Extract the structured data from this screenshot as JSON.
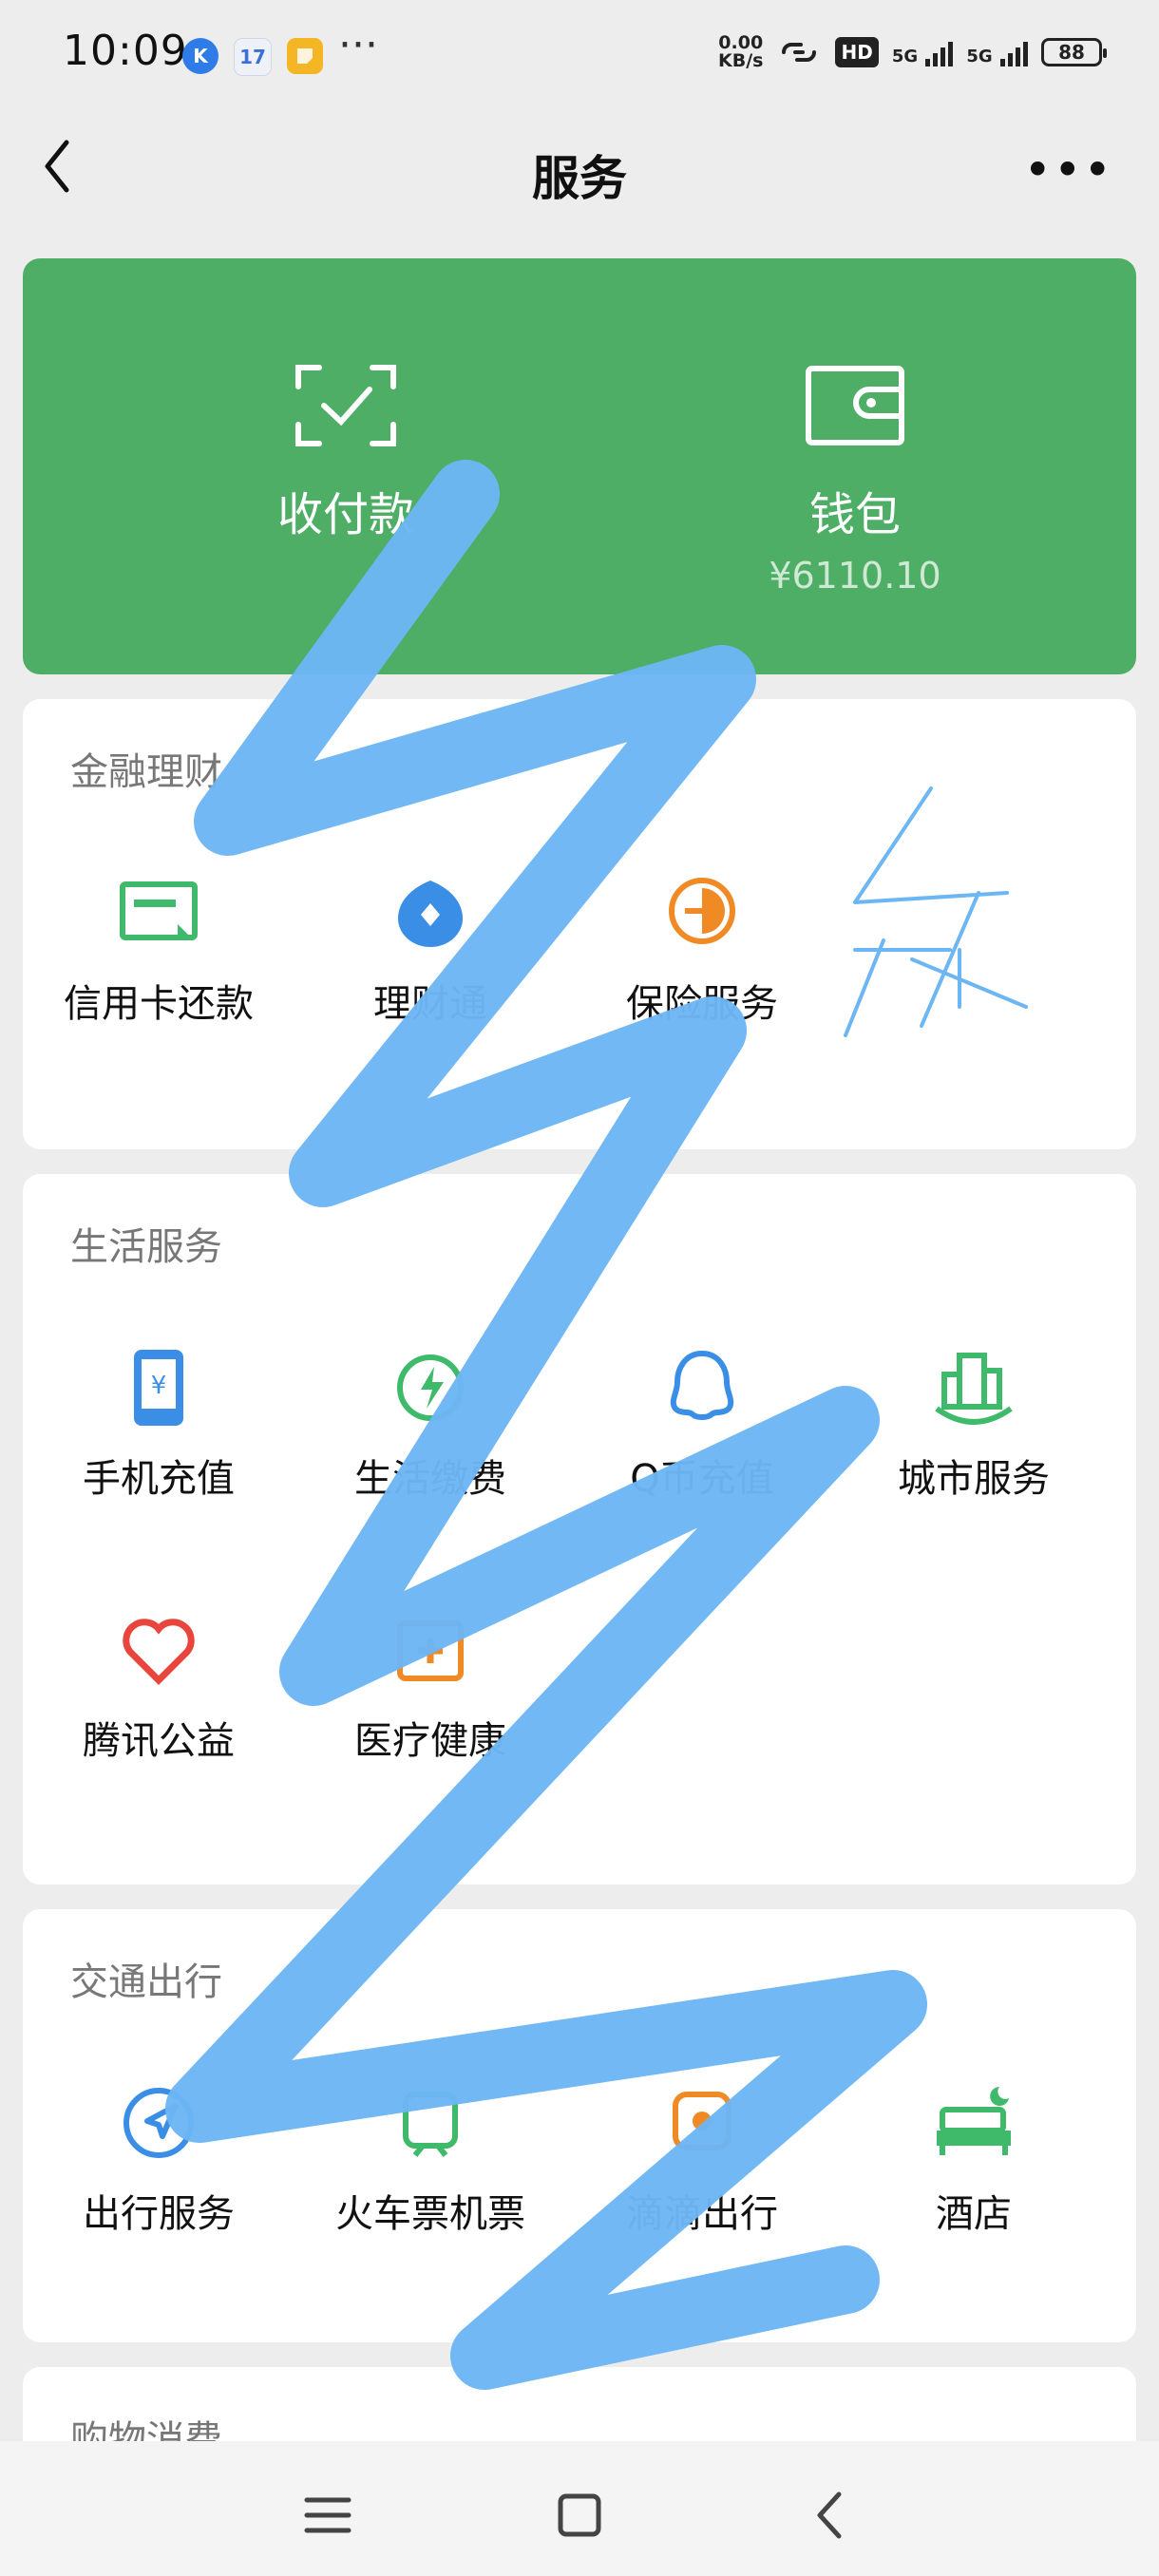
{
  "status_bar": {
    "time": "10:09",
    "notification_more": "···",
    "app_icons": [
      "K",
      "17",
      ""
    ],
    "net_speed_value": "0.00",
    "net_speed_unit": "KB/s",
    "hd_label": "HD",
    "sim1_label": "5G",
    "sim2_label": "5G",
    "battery": "88"
  },
  "nav": {
    "title": "服务",
    "more": "•••"
  },
  "pay_card": {
    "color": "#4fae66",
    "items": [
      {
        "label": "收付款",
        "icon": "scan-check-icon"
      },
      {
        "label": "钱包",
        "sub": "¥6110.10",
        "icon": "wallet-icon"
      }
    ]
  },
  "sections": [
    {
      "title": "金融理财",
      "items": [
        {
          "label": "信用卡还款",
          "icon": "credit-card-icon",
          "color": "#3fb96a"
        },
        {
          "label": "理财通",
          "icon": "wealth-icon",
          "color": "#3a8ee6"
        },
        {
          "label": "保险服务",
          "icon": "insurance-icon",
          "color": "#f08a24"
        }
      ]
    },
    {
      "title": "生活服务",
      "items": [
        {
          "label": "手机充值",
          "icon": "phone-recharge-icon",
          "color": "#3a8ee6"
        },
        {
          "label": "生活缴费",
          "icon": "utility-bill-icon",
          "color": "#3fb96a"
        },
        {
          "label": "Q币充值",
          "icon": "qq-icon",
          "color": "#3a8ee6"
        },
        {
          "label": "城市服务",
          "icon": "city-icon",
          "color": "#3fb96a"
        },
        {
          "label": "腾讯公益",
          "icon": "charity-icon",
          "color": "#e8453c"
        },
        {
          "label": "医疗健康",
          "icon": "medical-icon",
          "color": "#f08a24"
        }
      ]
    },
    {
      "title": "交通出行",
      "items": [
        {
          "label": "出行服务",
          "icon": "travel-icon",
          "color": "#3a8ee6"
        },
        {
          "label": "火车票机票",
          "icon": "ticket-icon",
          "color": "#3fb96a"
        },
        {
          "label": "滴滴出行",
          "icon": "didi-icon",
          "color": "#f08a24"
        },
        {
          "label": "酒店",
          "icon": "hotel-icon",
          "color": "#3fb96a"
        }
      ]
    },
    {
      "title": "购物消费",
      "items": []
    }
  ],
  "system_nav": {
    "buttons": [
      "menu-icon",
      "home-icon",
      "back-icon"
    ]
  }
}
